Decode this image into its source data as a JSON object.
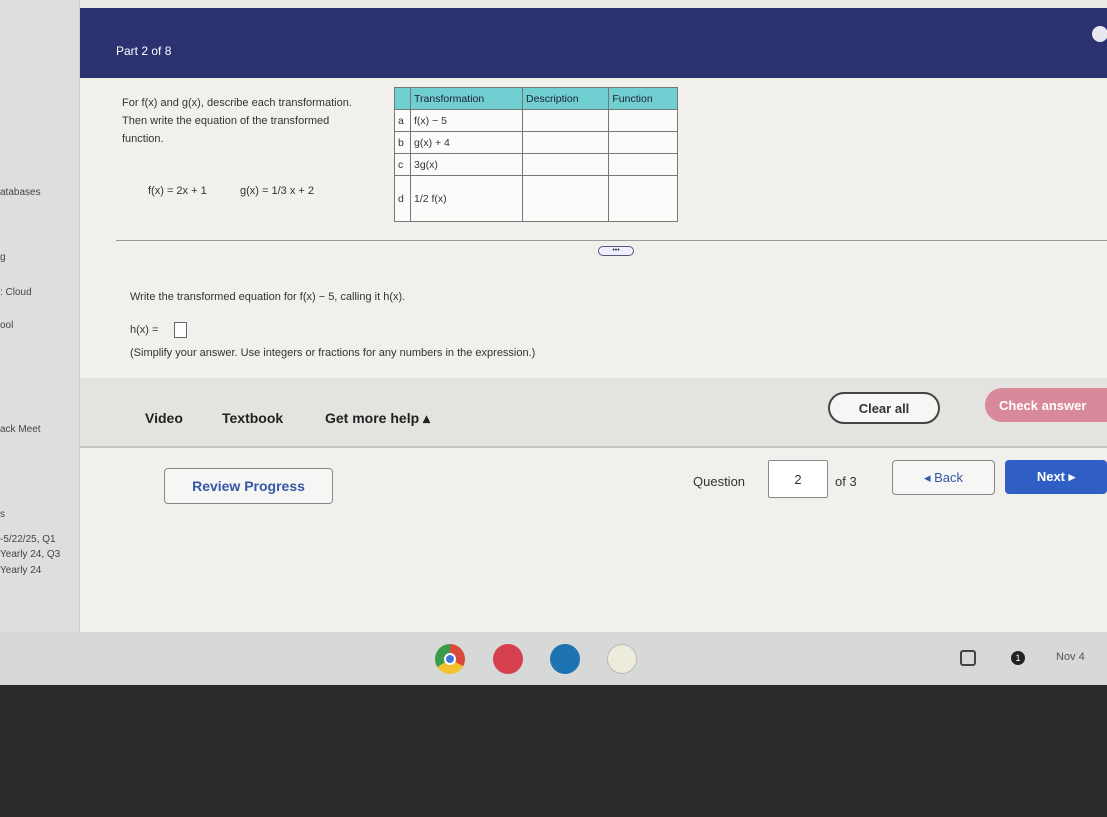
{
  "sidebar": {
    "items": [
      "atabases",
      "g",
      ": Cloud",
      "ool",
      "ack Meet",
      "s",
      "-5/22/25, Q1",
      "Yearly 24, Q3",
      "Yearly 24"
    ]
  },
  "header": {
    "title": "Part 2 of 8"
  },
  "problem": {
    "instructions": "For f(x) and g(x), describe each transformation. Then write the equation of the transformed function.",
    "f_def": "f(x) = 2x + 1",
    "g_def": "g(x) = 1/3 x + 2",
    "table": {
      "headers": [
        "Transformation",
        "Description",
        "Function"
      ],
      "rows": [
        {
          "letter": "a",
          "transformation": "f(x) − 5",
          "description": "",
          "function": ""
        },
        {
          "letter": "b",
          "transformation": "g(x) + 4",
          "description": "",
          "function": ""
        },
        {
          "letter": "c",
          "transformation": "3g(x)",
          "description": "",
          "function": ""
        },
        {
          "letter": "d",
          "transformation": "1/2 f(x)",
          "description": "",
          "function": ""
        }
      ]
    }
  },
  "expander_label": "•••",
  "question": {
    "prompt": "Write the transformed equation for f(x) − 5, calling it h(x).",
    "answer_label": "h(x) =",
    "answer_value": "",
    "hint": "(Simplify your answer. Use integers or fractions for any numbers in the expression.)"
  },
  "toolbar": {
    "video": "Video",
    "textbook": "Textbook",
    "help": "Get more help ▴",
    "clear_all": "Clear all",
    "check_answer": "Check answer"
  },
  "nav": {
    "review": "Review Progress",
    "question_label": "Question",
    "question_number": "2",
    "of_total": "of 3",
    "back": "◂ Back",
    "next": "Next ▸"
  },
  "taskbar": {
    "apps": [
      "chrome-icon",
      "red-app-icon",
      "blue-app-icon",
      "photo-app-icon"
    ],
    "date": "Nov 4",
    "notification_count": "1"
  },
  "colors": {
    "header": "#2c3270",
    "table_header": "#6fcfd1",
    "next": "#2f5fc4",
    "check": "#d98a9a"
  }
}
